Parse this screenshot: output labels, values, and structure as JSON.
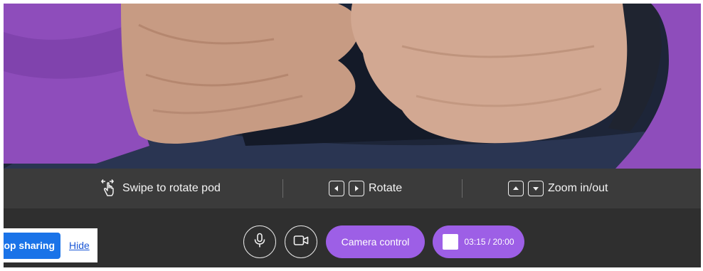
{
  "hints": {
    "swipe": {
      "label": "Swipe to rotate pod",
      "icon": "swipe-gesture-icon"
    },
    "rotate": {
      "label": "Rotate",
      "icons": [
        "arrow-left-key-icon",
        "arrow-right-key-icon"
      ]
    },
    "zoom": {
      "label": "Zoom in/out",
      "icons": [
        "arrow-up-key-icon",
        "arrow-down-key-icon"
      ]
    }
  },
  "controls": {
    "mic_icon": "microphone-icon",
    "camera_icon": "video-camera-icon",
    "camera_control_label": "Camera control",
    "recording_timer": "03:15 / 20:00"
  },
  "share_notice": {
    "stop_label": "Stop sharing",
    "hide_label": "Hide"
  },
  "colors": {
    "accent": "#9d5fe6",
    "share_button": "#1a73e8",
    "bar_background": "#3b3b3b",
    "control_background": "#2f2f2f"
  }
}
